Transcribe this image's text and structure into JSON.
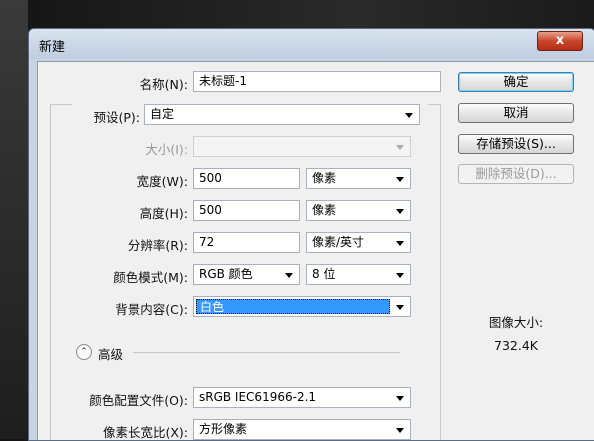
{
  "dialog": {
    "title": "新建",
    "close_label": "x"
  },
  "form": {
    "name": {
      "label": "名称(N):",
      "value": "未标题-1"
    },
    "preset": {
      "label": "预设(P):",
      "value": "自定"
    },
    "size": {
      "label": "大小(I):",
      "value": ""
    },
    "width": {
      "label": "宽度(W):",
      "value": "500",
      "unit": "像素"
    },
    "height": {
      "label": "高度(H):",
      "value": "500",
      "unit": "像素"
    },
    "resolution": {
      "label": "分辨率(R):",
      "value": "72",
      "unit": "像素/英寸"
    },
    "color_mode": {
      "label": "颜色模式(M):",
      "mode": "RGB 颜色",
      "depth": "8 位"
    },
    "background": {
      "label": "背景内容(C):",
      "value": "白色"
    },
    "advanced_label": "高级",
    "color_profile": {
      "label": "颜色配置文件(O):",
      "value": "sRGB IEC61966-2.1"
    },
    "pixel_aspect": {
      "label": "像素长宽比(X):",
      "value": "方形像素"
    }
  },
  "buttons": {
    "ok": "确定",
    "cancel": "取消",
    "save_preset": "存储预设(S)...",
    "delete_preset": "删除预设(D)..."
  },
  "image_size": {
    "label": "图像大小:",
    "value": "732.4K"
  }
}
